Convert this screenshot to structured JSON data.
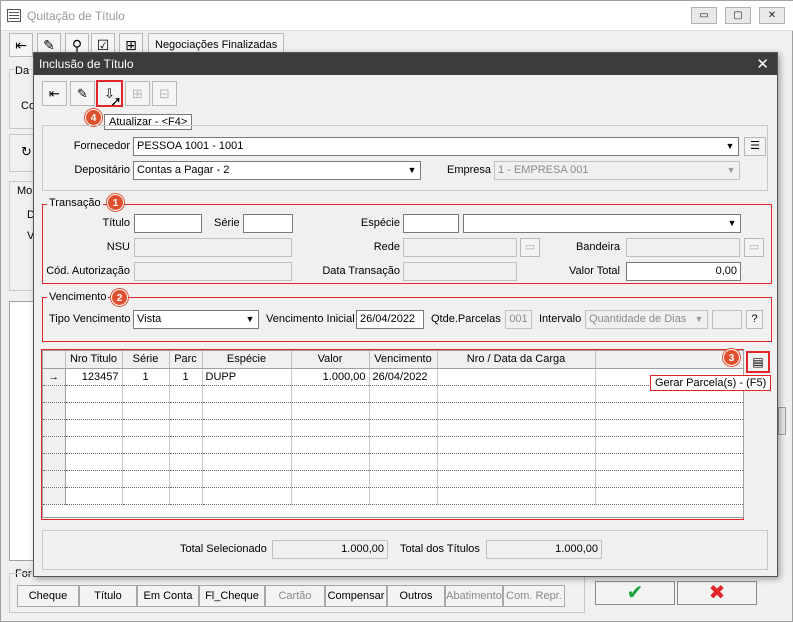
{
  "main_window": {
    "title": "Quitação de Título",
    "controls": {
      "minimize": "▭",
      "maximize": "▢",
      "close": "✕"
    },
    "toolbar": {
      "negociacoes_label": "Negociações Finalizadas"
    },
    "side_labels": {
      "da": "Da",
      "co": "Co",
      "mo": "Mo",
      "d": "D",
      "v": "V",
      "for": "For"
    },
    "bottom_buttons": [
      {
        "label": "Cheque",
        "enabled": true
      },
      {
        "label": "Título",
        "enabled": true
      },
      {
        "label": "Em Conta",
        "enabled": true
      },
      {
        "label": "Fl_Cheque",
        "enabled": true
      },
      {
        "label": "Cartão",
        "enabled": false
      },
      {
        "label": "Compensar",
        "enabled": true
      },
      {
        "label": "Outros",
        "enabled": true
      },
      {
        "label": "Abatimento",
        "enabled": false
      },
      {
        "label": "Com. Repr.",
        "enabled": false
      }
    ],
    "ok_glyph": "✔",
    "cancel_glyph": "✖",
    "ok_color": "#1aa33a",
    "cancel_color": "#e0262b"
  },
  "dialog": {
    "title": "Inclusão de Título",
    "close_glyph": "✕",
    "update_tooltip": "Atualizar - <F4>",
    "badge_4": "4",
    "fornecedor": {
      "label": "Fornecedor",
      "value": "PESSOA 1001 - 1001"
    },
    "depositario": {
      "label": "Depositário",
      "value": "Contas a Pagar - 2"
    },
    "empresa": {
      "label": "Empresa",
      "value": "1 - EMPRESA 001"
    },
    "transacao": {
      "legend": "Transação",
      "badge": "1",
      "titulo_label": "Título",
      "titulo_value": "",
      "serie_label": "Série",
      "serie_value": "",
      "especie_label": "Espécie",
      "especie_code": "",
      "especie_value": "",
      "nsu_label": "NSU",
      "nsu_value": "",
      "rede_label": "Rede",
      "rede_value": "",
      "bandeira_label": "Bandeira",
      "bandeira_value": "",
      "cod_autorizacao_label": "Cód. Autorização",
      "cod_autorizacao_value": "",
      "data_transacao_label": "Data Transação",
      "data_transacao_value": "",
      "valor_total_label": "Valor Total",
      "valor_total_value": "0,00"
    },
    "vencimento": {
      "legend": "Vencimento",
      "badge": "2",
      "tipo_label": "Tipo Vencimento",
      "tipo_value": "Vista",
      "inicial_label": "Vencimento Inicial",
      "inicial_value": "26/04/2022",
      "qtde_label": "Qtde.Parcelas",
      "qtde_value": "001",
      "intervalo_label": "Intervalo",
      "intervalo_value": "Quantidade de Dias",
      "intervalo_num": "",
      "help_label": "?"
    },
    "grid": {
      "badge": "3",
      "gerar_tooltip": "Gerar Parcela(s) - (F5)",
      "columns": [
        "",
        "Nro Titulo",
        "Série",
        "Parc",
        "Espécie",
        "Valor",
        "Vencimento",
        "Nro / Data da Carga",
        ""
      ],
      "rows": [
        {
          "indicator": "→",
          "nro_titulo": "123457",
          "serie": "1",
          "parc": "1",
          "especie": "DUPP",
          "valor": "1.000,00",
          "vencimento": "26/04/2022",
          "nro_data_carga": "",
          "extra": ""
        }
      ]
    },
    "totals": {
      "total_selecionado_label": "Total Selecionado",
      "total_selecionado_value": "1.000,00",
      "total_titulos_label": "Total dos Títulos",
      "total_titulos_value": "1.000,00"
    }
  }
}
